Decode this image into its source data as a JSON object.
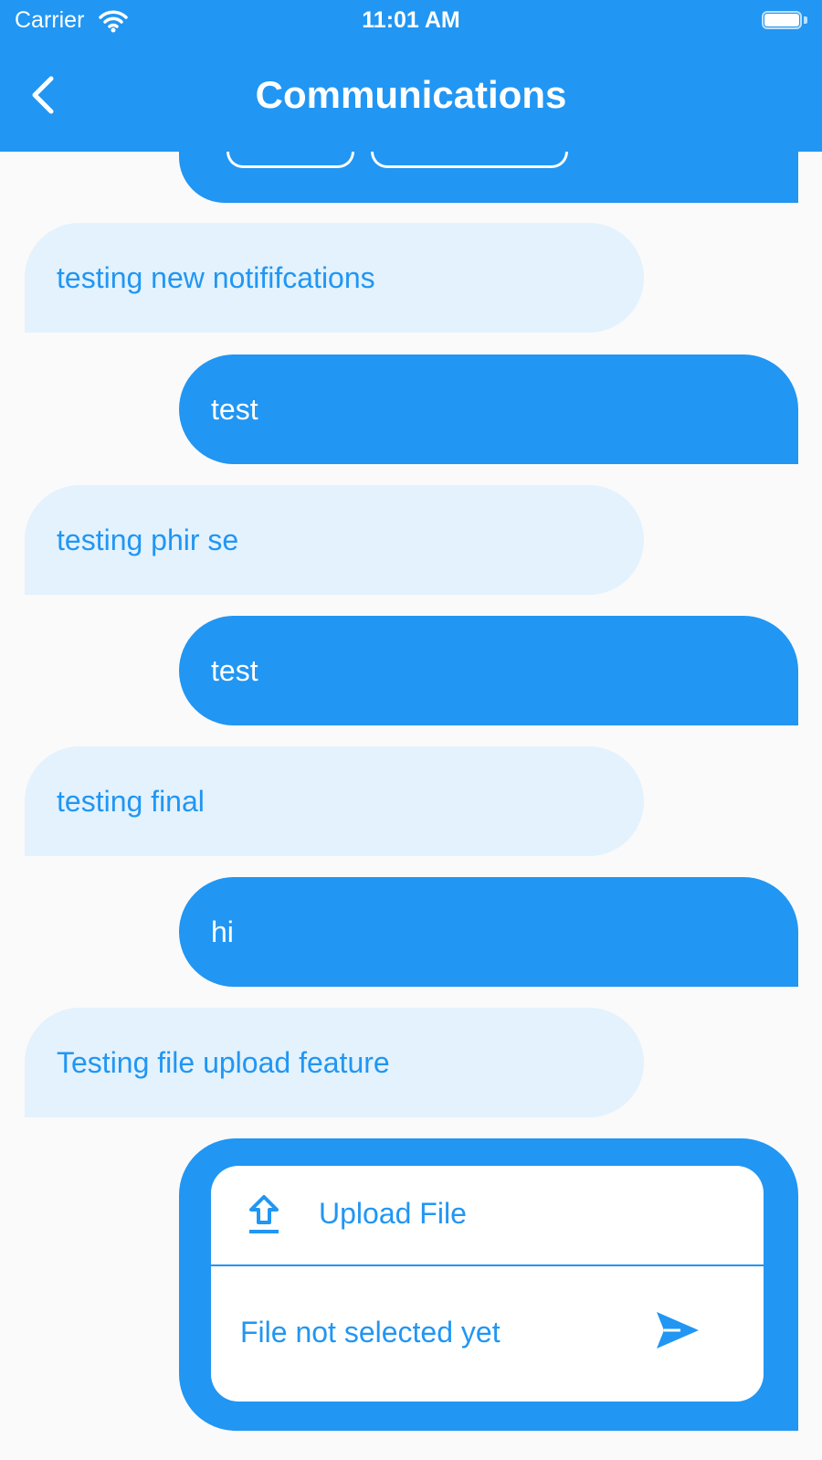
{
  "status_bar": {
    "carrier": "Carrier",
    "time": "11:01 AM",
    "wifi_icon": "wifi-icon",
    "battery_icon": "battery-icon"
  },
  "appbar": {
    "title": "Communications",
    "back_icon": "chevron-left-icon",
    "background_color": "#2196f3"
  },
  "messages": [
    {
      "side": "incoming",
      "text": "testing new notififcations"
    },
    {
      "side": "outgoing",
      "text": "test"
    },
    {
      "side": "incoming",
      "text": "testing phir se"
    },
    {
      "side": "outgoing",
      "text": "test"
    },
    {
      "side": "incoming",
      "text": "testing final"
    },
    {
      "side": "outgoing",
      "text": "hi"
    },
    {
      "side": "incoming",
      "text": "Testing file upload feature"
    }
  ],
  "upload": {
    "label": "Upload File",
    "file_status": "File not selected yet",
    "upload_icon": "upload-icon",
    "send_icon": "send-icon"
  },
  "colors": {
    "primary": "#2196f3",
    "incoming_bubble": "#e3f2fd",
    "background": "#fafafa"
  }
}
